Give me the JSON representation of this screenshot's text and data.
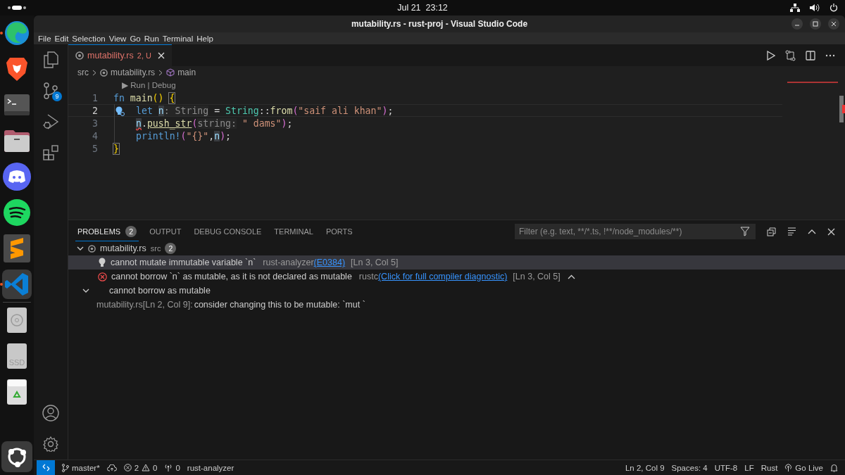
{
  "topbar": {
    "clock": "Jul 21  23:12"
  },
  "dock": [
    {
      "kind": "edge",
      "running": true,
      "selected": false
    },
    {
      "kind": "brave",
      "running": false,
      "selected": false
    },
    {
      "kind": "terminal",
      "running": false,
      "selected": false
    },
    {
      "kind": "files",
      "running": false,
      "selected": false
    },
    {
      "kind": "discord",
      "running": false,
      "selected": false
    },
    {
      "kind": "spotify",
      "running": false,
      "selected": false
    },
    {
      "kind": "sublime",
      "running": false,
      "selected": false
    },
    {
      "kind": "vscode",
      "running": true,
      "selected": true
    },
    {
      "kind": "disc",
      "running": false,
      "selected": false
    },
    {
      "kind": "drive",
      "label": "SSD",
      "running": false,
      "selected": false
    },
    {
      "kind": "trash",
      "running": false,
      "selected": false
    }
  ],
  "window": {
    "title": "mutability.rs - rust-proj - Visual Studio Code"
  },
  "menu": [
    "File",
    "Edit",
    "Selection",
    "View",
    "Go",
    "Run",
    "Terminal",
    "Help"
  ],
  "activity_bar": [
    {
      "kind": "explorer"
    },
    {
      "kind": "source-control",
      "badge": "9"
    },
    {
      "kind": "run-debug"
    },
    {
      "kind": "extensions"
    }
  ],
  "tabs": [
    {
      "label": "mutability.rs",
      "status": "2, U",
      "selected": true
    }
  ],
  "breadcrumbs": [
    {
      "text": "src",
      "kind": "folder"
    },
    {
      "text": "mutability.rs",
      "kind": "rust-file"
    },
    {
      "text": "main",
      "kind": "symbol"
    }
  ],
  "editor": {
    "codelens": "▶ Run | Debug",
    "lines": [
      {
        "number": "1",
        "current": false,
        "indent": false,
        "tokens": [
          {
            "text": "fn ",
            "kind": "keyword"
          },
          {
            "text": "main",
            "kind": "function"
          },
          {
            "text": "() ",
            "kind": "brace"
          },
          {
            "text": "{",
            "kind": "brace-match"
          }
        ]
      },
      {
        "number": "2",
        "current": true,
        "indent": true,
        "tokens": [
          {
            "text": "let ",
            "kind": "keyword"
          },
          {
            "text": "n",
            "kind": "variable",
            "highlight": true
          },
          {
            "text": ": String",
            "kind": "hint"
          },
          {
            "text": " = ",
            "kind": "plain"
          },
          {
            "text": "String",
            "kind": "type"
          },
          {
            "text": "::",
            "kind": "plain"
          },
          {
            "text": "from",
            "kind": "function"
          },
          {
            "text": "(",
            "kind": "paren"
          },
          {
            "text": "\"saif ali khan\"",
            "kind": "string"
          },
          {
            "text": ")",
            "kind": "paren"
          },
          {
            "text": ";",
            "kind": "plain"
          }
        ]
      },
      {
        "number": "3",
        "current": false,
        "indent": true,
        "tokens": [
          {
            "text": "n",
            "kind": "variable",
            "highlight": true,
            "error": true
          },
          {
            "text": ".",
            "kind": "plain"
          },
          {
            "text": "push_str",
            "kind": "function",
            "underline": true
          },
          {
            "text": "(",
            "kind": "paren"
          },
          {
            "text": "string:",
            "kind": "hint"
          },
          {
            "text": " \" dams\"",
            "kind": "string"
          },
          {
            "text": ")",
            "kind": "paren"
          },
          {
            "text": ";",
            "kind": "plain"
          }
        ]
      },
      {
        "number": "4",
        "current": false,
        "indent": true,
        "tokens": [
          {
            "text": "println!",
            "kind": "keyword"
          },
          {
            "text": "(",
            "kind": "paren"
          },
          {
            "text": "\"{}\"",
            "kind": "string"
          },
          {
            "text": ",",
            "kind": "plain"
          },
          {
            "text": "n",
            "kind": "variable",
            "highlight": true
          },
          {
            "text": ")",
            "kind": "paren"
          },
          {
            "text": ";",
            "kind": "plain"
          }
        ]
      },
      {
        "number": "5",
        "current": false,
        "indent": false,
        "tokens": [
          {
            "text": "}",
            "kind": "brace-match"
          }
        ]
      }
    ]
  },
  "panel": {
    "tabs": [
      {
        "label": "PROBLEMS",
        "badge": "2",
        "selected": true
      },
      {
        "label": "OUTPUT",
        "selected": false
      },
      {
        "label": "DEBUG CONSOLE",
        "selected": false
      },
      {
        "label": "TERMINAL",
        "selected": false
      },
      {
        "label": "PORTS",
        "selected": false
      }
    ],
    "filter": {
      "placeholder": "Filter (e.g. text, **/*.ts, !**/node_modules/**)"
    },
    "problems": [
      {
        "file": "mutability.rs",
        "folder": "src",
        "count": "2",
        "expanded": true,
        "items": [
          {
            "kind": "hint",
            "selected": true,
            "message": "cannot mutate immutable variable `n`",
            "source": "rust-analyzer",
            "code": "(E0384)",
            "location": "[Ln 3, Col 5]"
          },
          {
            "kind": "error",
            "selected": false,
            "expanded": true,
            "message": "cannot borrow `n` as mutable, as it is not declared as mutable",
            "source": "rustc",
            "code": "(Click for full compiler diagnostic)",
            "location": "[Ln 3, Col 5]",
            "details": [
              "cannot borrow as mutable"
            ],
            "related": {
              "location": "mutability.rs[Ln 2, Col 9]:",
              "message": "consider changing this to be mutable: `mut `"
            }
          }
        ]
      }
    ]
  },
  "status_bar": {
    "branch": "master*",
    "errors": "2",
    "warnings": "0",
    "ports": "0",
    "language_server": "rust-analyzer",
    "right": [
      "Ln 2, Col 9",
      "Spaces: 4",
      "UTF-8",
      "LF",
      "Rust"
    ],
    "go_live": "Go Live"
  }
}
